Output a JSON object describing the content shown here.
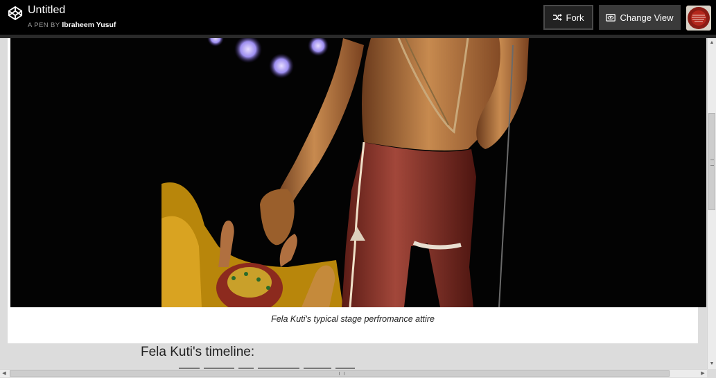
{
  "header": {
    "title": "Untitled",
    "byline_prefix": "A PEN BY",
    "author": "Ibraheem Yusuf",
    "buttons": {
      "fork": "Fork",
      "change_view": "Change View"
    },
    "icons": {
      "logo": "codepen-logo-icon",
      "fork": "fork-icon",
      "view": "eye-icon"
    }
  },
  "content": {
    "caption": "Fela Kuti's typical stage perfromance attire",
    "timeline_heading": "Fela Kuti's timeline:"
  },
  "colors": {
    "header_bg": "#000000",
    "page_bg": "#dcdcdc",
    "trousers": "#8e3326",
    "stage_light": "#9a8cff"
  }
}
